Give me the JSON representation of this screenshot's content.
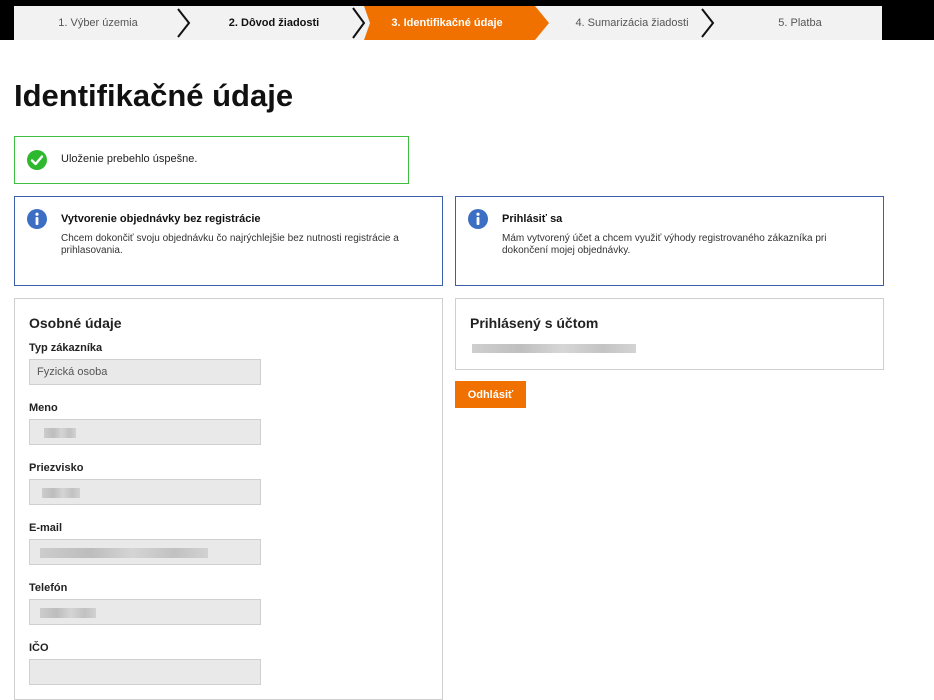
{
  "steps": [
    {
      "label": "1. Výber územia",
      "state": "done"
    },
    {
      "label": "2. Dôvod žiadosti",
      "state": "done-bold"
    },
    {
      "label": "3. Identifikačné údaje",
      "state": "active"
    },
    {
      "label": "4. Sumarizácia žiadosti",
      "state": "pending"
    },
    {
      "label": "5. Platba",
      "state": "pending"
    }
  ],
  "page": {
    "title": "Identifikačné údaje"
  },
  "success": {
    "message": "Uloženie prebehlo úspešne."
  },
  "guest_box": {
    "heading": "Vytvorenie objednávky bez registrácie",
    "text_line1": "Chcem dokončiť svoju objednávku čo najrýchlejšie bez nutnosti registrácie a",
    "text_line2": "prihlasovania."
  },
  "login_box": {
    "heading": "Prihlásiť sa",
    "text_line1": "Mám vytvorený účet a chcem využiť výhody registrovaného zákazníka pri",
    "text_line2": "dokončení mojej objednávky."
  },
  "personal": {
    "heading": "Osobné údaje",
    "customer_type_label": "Typ zákazníka",
    "customer_type_value": "Fyzická osoba",
    "name_label": "Meno",
    "surname_label": "Priezvisko",
    "email_label": "E-mail",
    "phone_label": "Telefón",
    "ico_label": "IČO"
  },
  "account": {
    "heading": "Prihlásený s účtom",
    "logout_label": "Odhlásiť"
  },
  "colors": {
    "accent": "#f07000",
    "success": "#3fbf3f",
    "info_border": "#3c5ea8"
  },
  "icons": {
    "success": "check-circle-icon",
    "info": "info-circle-icon"
  }
}
